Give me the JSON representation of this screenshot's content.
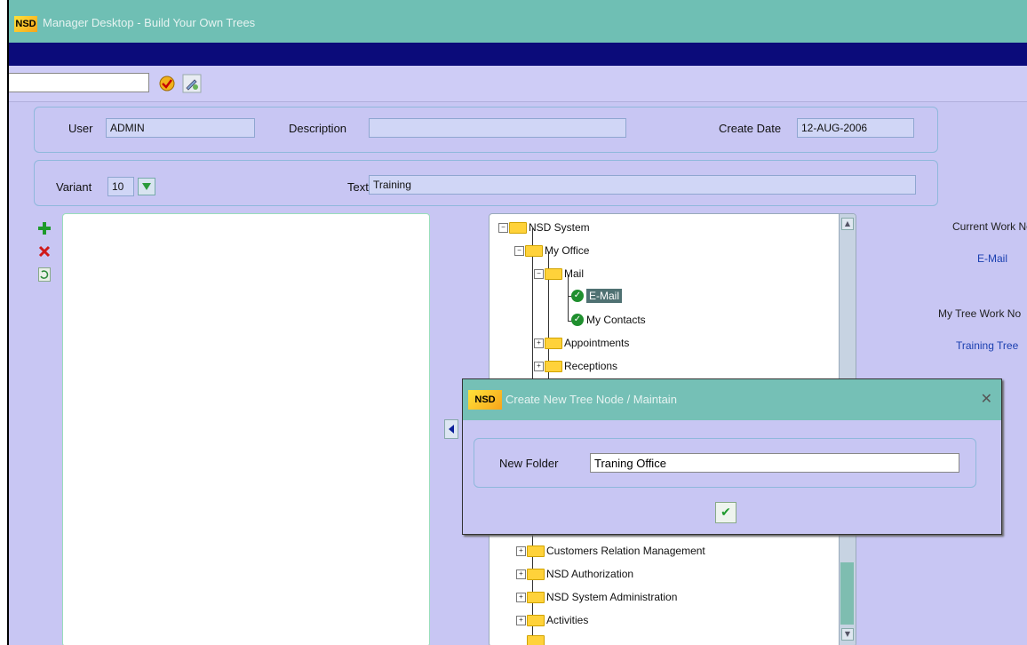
{
  "window": {
    "title": "Manager Desktop - Build Your Own Trees",
    "logo": "NSD"
  },
  "toolbar": {
    "search_value": "",
    "ok_icon": "check-circle-icon",
    "edit_icon": "pencil-icon"
  },
  "header_panel": {
    "user_label": "User",
    "user_value": "ADMIN",
    "description_label": "Description",
    "description_value": "",
    "create_date_label": "Create Date",
    "create_date_value": "12-AUG-2006"
  },
  "variant_panel": {
    "variant_label": "Variant",
    "variant_value": "10",
    "text_label": "Text",
    "text_value": "Training"
  },
  "side_buttons": {
    "add": "+",
    "delete": "✕",
    "refresh": "↻"
  },
  "tree": {
    "nodes": [
      {
        "label": "NSD  System"
      },
      {
        "label": "My Office"
      },
      {
        "label": "Mail"
      },
      {
        "label": "E-Mail"
      },
      {
        "label": "My Contacts"
      },
      {
        "label": "Appointments"
      },
      {
        "label": "Receptions"
      },
      {
        "label": "Customers Relation Management"
      },
      {
        "label": "NSD Authorization"
      },
      {
        "label": "NSD System Administration"
      },
      {
        "label": "Activities"
      }
    ]
  },
  "right_info": {
    "current_work_label": "Current Work No",
    "current_work_value": "E-Mail",
    "my_tree_label": "My Tree Work No",
    "my_tree_value": "Training Tree"
  },
  "dialog": {
    "logo": "NSD",
    "title": "Create New Tree Node / Maintain",
    "close": "✕",
    "folder_label": "New Folder",
    "folder_value": "Traning Office",
    "confirm": "✔"
  },
  "colors": {
    "titlebar": "#6fbfb4",
    "navbar": "#0b0b7a",
    "background": "#c8c6f3",
    "link": "#1a3fb0"
  }
}
